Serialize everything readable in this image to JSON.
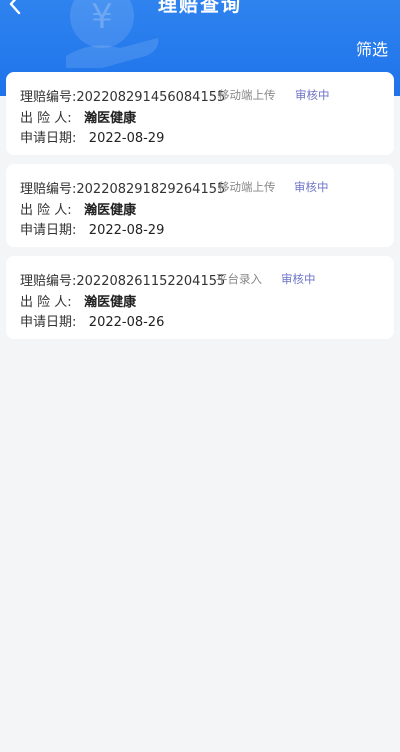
{
  "header": {
    "title": "理赔查询",
    "filter_label": "筛选",
    "accent": "#1e73ea"
  },
  "claims": [
    {
      "no_label": "理赔编号:",
      "no": "202208291456084155",
      "source": "移动端上传",
      "status": "审核中",
      "insurer_label": "出 险 人:",
      "insurer": "瀚医健康",
      "date_label": "申请日期:",
      "date": "2022-08-29"
    },
    {
      "no_label": "理赔编号:",
      "no": "202208291829264155",
      "source": "移动端上传",
      "status": "审核中",
      "insurer_label": "出 险 人:",
      "insurer": "瀚医健康",
      "date_label": "申请日期:",
      "date": "2022-08-29"
    },
    {
      "no_label": "理赔编号:",
      "no": "202208261152204155",
      "source": "平台录入",
      "status": "审核中",
      "insurer_label": "出 险 人:",
      "insurer": "瀚医健康",
      "date_label": "申请日期:",
      "date": "2022-08-26"
    }
  ]
}
